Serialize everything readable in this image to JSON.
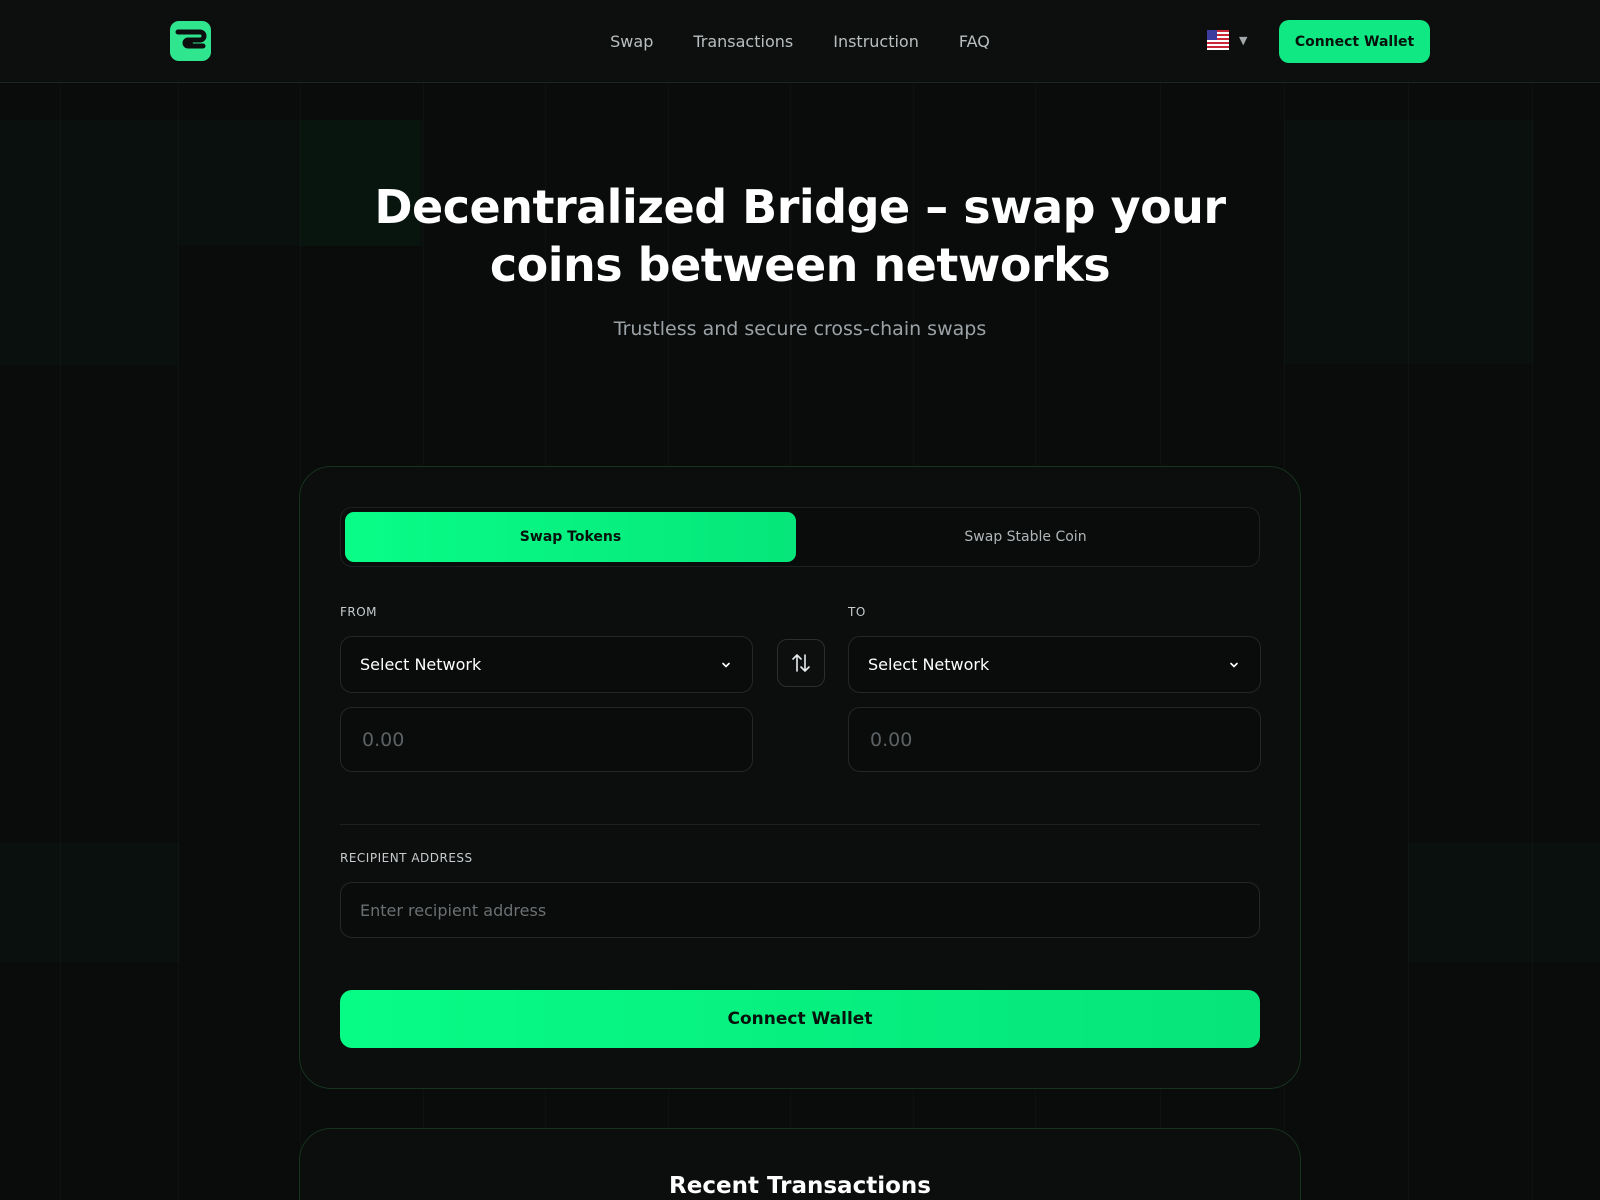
{
  "header": {
    "nav": [
      {
        "label": "Swap"
      },
      {
        "label": "Transactions"
      },
      {
        "label": "Instruction"
      },
      {
        "label": "FAQ"
      }
    ],
    "language": {
      "icon": "us-flag-icon",
      "caret": "▼"
    },
    "connect_label": "Connect Wallet"
  },
  "hero": {
    "title": "Decentralized Bridge – swap your coins between networks",
    "subtitle": "Trustless and secure cross-chain swaps"
  },
  "swap": {
    "tabs": [
      {
        "label": "Swap Tokens",
        "active": true
      },
      {
        "label": "Swap Stable Coin",
        "active": false
      }
    ],
    "from": {
      "label": "FROM",
      "network": "Select Network",
      "amount_placeholder": "0.00"
    },
    "to": {
      "label": "TO",
      "network": "Select Network",
      "amount_placeholder": "0.00"
    },
    "recipient": {
      "label": "RECIPIENT ADDRESS",
      "placeholder": "Enter recipient address"
    },
    "submit_label": "Connect Wallet"
  },
  "recent": {
    "title": "Recent Transactions"
  },
  "colors": {
    "accent": "#08fd87",
    "background": "#0a0b0b"
  }
}
